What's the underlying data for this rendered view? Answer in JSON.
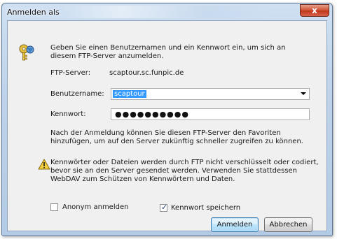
{
  "window": {
    "title": "Anmelden als",
    "close_label": "x"
  },
  "intro": "Geben Sie einen Benutzernamen und ein Kennwort ein, um sich an diesem FTP-Server anzumelden.",
  "server": {
    "label": "FTP-Server:",
    "value": "scaptour.sc.funpic.de"
  },
  "username": {
    "label": "Benutzername:",
    "value": "scaptour"
  },
  "password": {
    "label": "Kennwort:",
    "masked_value": "●●●●●●●●●●"
  },
  "favorites_note": "Nach der Anmeldung können Sie diesen FTP-Server den Favoriten hinzufügen, um auf den Server zukünftig schneller zugreifen zu können.",
  "warning_note": "Kennwörter oder Dateien werden durch FTP nicht verschlüsselt oder codiert, bevor sie an den Server gesendet werden. Verwenden Sie stattdessen WebDAV zum Schützen von Kennwörtern und Daten.",
  "anonymous": {
    "label": "Anonym anmelden",
    "checked": false
  },
  "save_password": {
    "label": "Kennwort speichern",
    "checked": true
  },
  "buttons": {
    "login": "Anmelden",
    "cancel": "Abbrechen"
  }
}
